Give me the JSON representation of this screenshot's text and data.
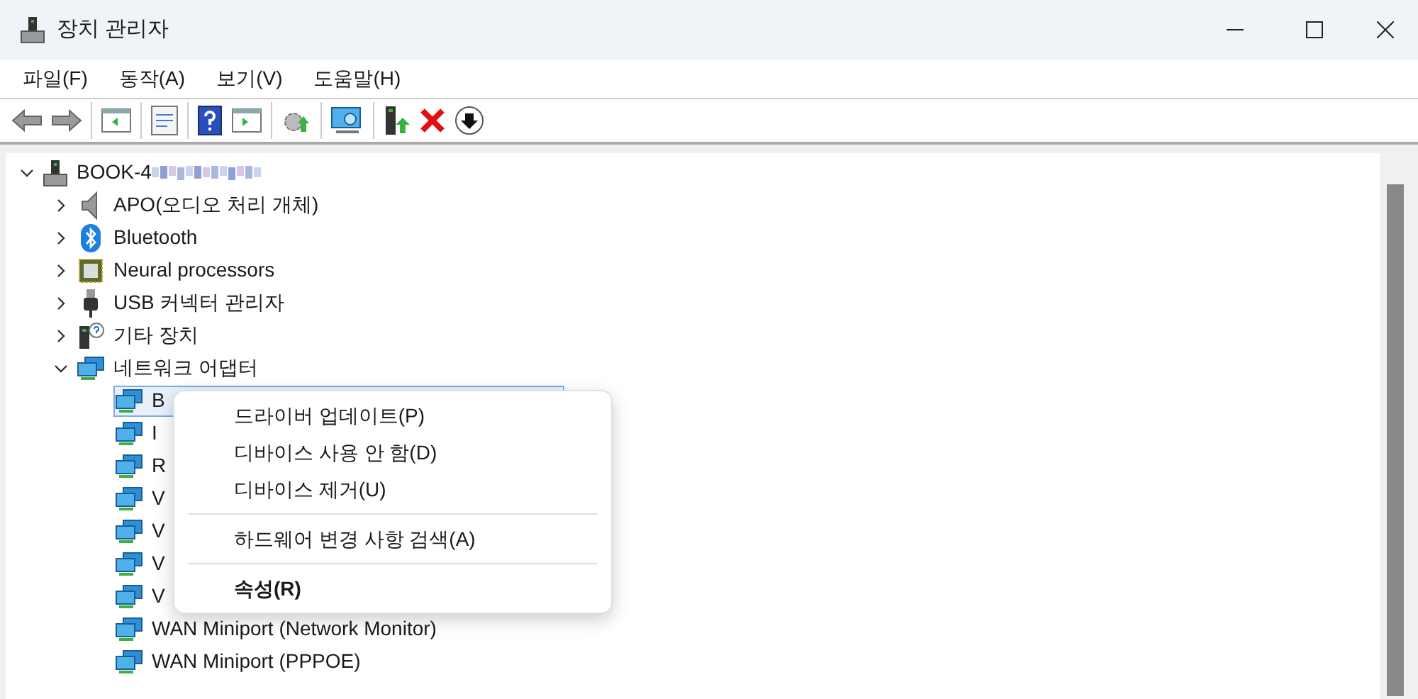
{
  "window": {
    "title": "장치 관리자"
  },
  "menu_bar": [
    "파일(F)",
    "동작(A)",
    "보기(V)",
    "도움말(H)"
  ],
  "toolbar": [
    {
      "kind": "back",
      "disabled": true
    },
    {
      "kind": "forward",
      "disabled": true
    },
    {
      "kind": "sep"
    },
    {
      "kind": "tree"
    },
    {
      "kind": "sep"
    },
    {
      "kind": "props"
    },
    {
      "kind": "sep"
    },
    {
      "kind": "help"
    },
    {
      "kind": "panel"
    },
    {
      "kind": "sep"
    },
    {
      "kind": "update"
    },
    {
      "kind": "sep"
    },
    {
      "kind": "scan"
    },
    {
      "kind": "sep"
    },
    {
      "kind": "enable"
    },
    {
      "kind": "remove"
    },
    {
      "kind": "disable"
    }
  ],
  "tree": {
    "label": "BOOK-4",
    "expanded": true,
    "children": [
      {
        "label": "APO(오디오 처리 개체)",
        "expanded": false
      },
      {
        "label": "Bluetooth",
        "expanded": false
      },
      {
        "label": "Neural processors",
        "expanded": false
      },
      {
        "label": "USB 커넥터 관리자",
        "expanded": false
      },
      {
        "label": "기타 장치",
        "expanded": false
      },
      {
        "label": "네트워크 어댑터",
        "expanded": true,
        "children": [
          {
            "label": "B",
            "selected": true
          },
          {
            "label": "I",
            "selected": false
          },
          {
            "label": "R",
            "selected": false
          },
          {
            "label": "V",
            "selected": false
          },
          {
            "label": "V",
            "selected": false
          },
          {
            "label": "V",
            "selected": false
          },
          {
            "label": "V",
            "selected": false
          },
          {
            "label": "WAN Miniport (Network Monitor)",
            "selected": false
          },
          {
            "label": "WAN Miniport (PPPOE)",
            "selected": false
          }
        ]
      }
    ]
  },
  "context_menu": [
    {
      "kind": "item",
      "label": "드라이버 업데이트(P)",
      "default": false
    },
    {
      "kind": "item",
      "label": "디바이스 사용 안 함(D)",
      "default": false
    },
    {
      "kind": "item",
      "label": "디바이스 제거(U)",
      "default": false
    },
    {
      "kind": "separator"
    },
    {
      "kind": "item",
      "label": "하드웨어 변경 사항 검색(A)",
      "default": false
    },
    {
      "kind": "separator"
    },
    {
      "kind": "item",
      "label": "속성(R)",
      "default": true
    }
  ]
}
